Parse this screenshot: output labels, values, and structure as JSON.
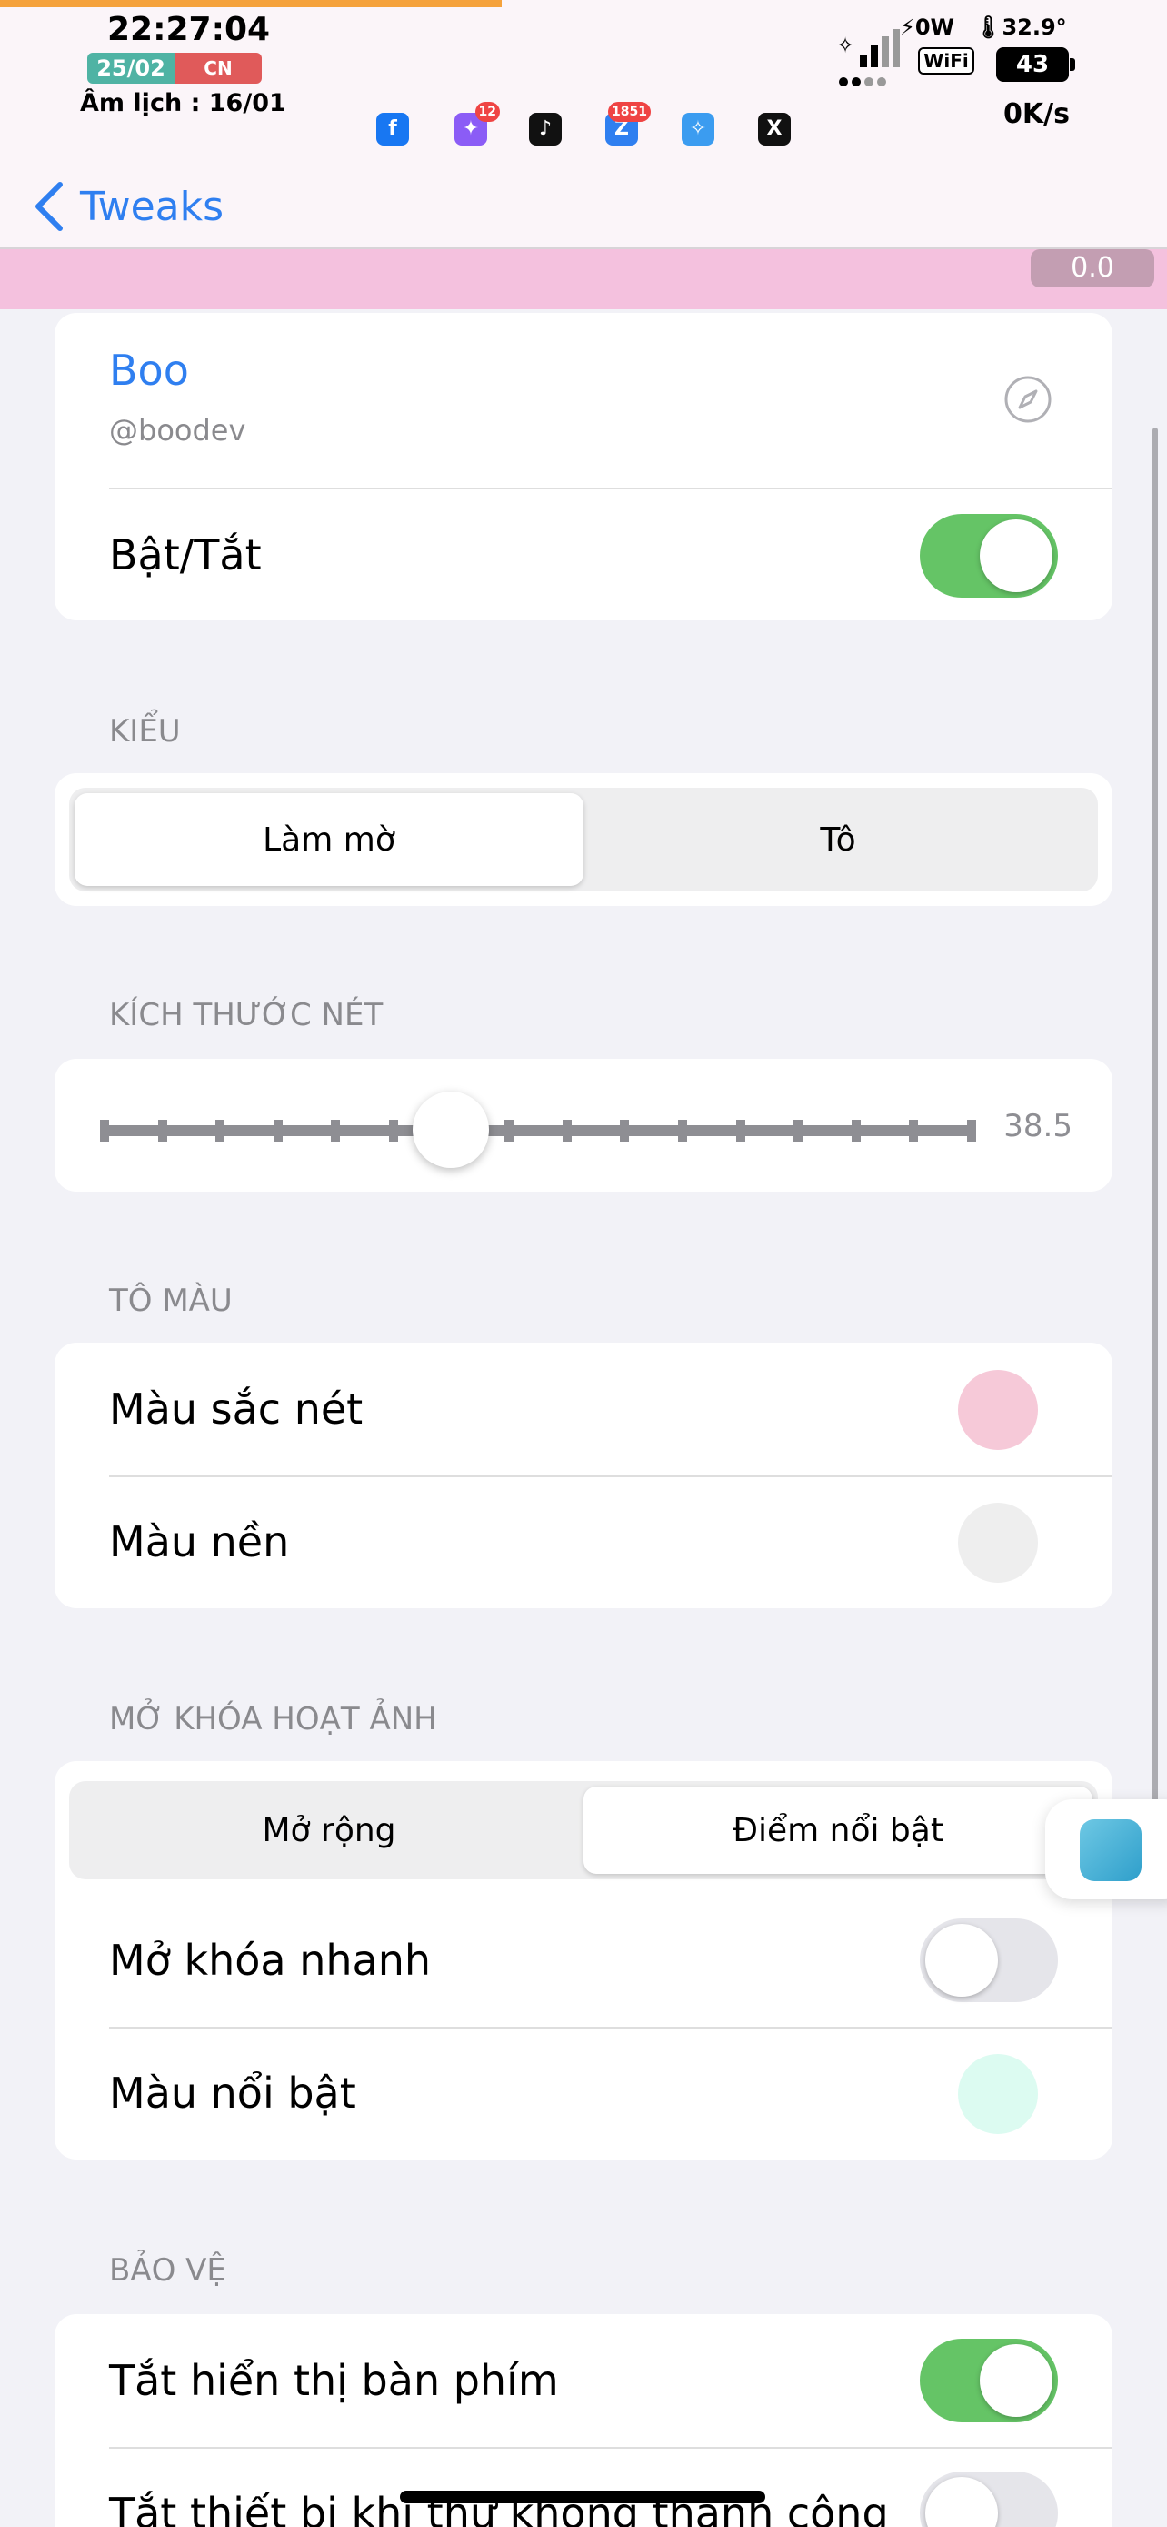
{
  "status_bar": {
    "time": "22:27:04",
    "date": "25/02",
    "day": "CN",
    "lunar": "Âm lịch : 16/01",
    "wattage": "⚡0W",
    "temperature": "🌡32.9°",
    "wifi": "WiFi",
    "battery": "43",
    "net_speed": "0K/s",
    "apps": [
      {
        "name": "facebook-icon",
        "glyph": "f",
        "color": "#1877f2",
        "badge": ""
      },
      {
        "name": "messenger-icon",
        "glyph": "✦",
        "color": "#8b5cf6",
        "badge": "12"
      },
      {
        "name": "tiktok-icon",
        "glyph": "♪",
        "color": "#111111",
        "badge": ""
      },
      {
        "name": "zalo-icon",
        "glyph": "Z",
        "color": "#2f7ff0",
        "badge": "1851"
      },
      {
        "name": "safari-icon",
        "glyph": "✧",
        "color": "#3b9cf0",
        "badge": ""
      },
      {
        "name": "x-icon",
        "glyph": "X",
        "color": "#111111",
        "badge": ""
      }
    ]
  },
  "nav": {
    "back_label": "Tweaks"
  },
  "version": "0.0",
  "profile": {
    "name": "Boo",
    "handle": "@boodev",
    "enabled_label": "Bật/Tắt",
    "enabled": true
  },
  "style_section": {
    "title": "KIỂU",
    "options": [
      "Làm mờ",
      "Tô"
    ],
    "selected": 0
  },
  "stroke_section": {
    "title": "KÍCH THƯỚC NÉT",
    "value": "38.5",
    "fraction": 0.4
  },
  "color_section": {
    "title": "TÔ MÀU",
    "stroke_color_label": "Màu sắc nét",
    "stroke_color": "#f6c9d8",
    "bg_color_label": "Màu nền",
    "bg_color": "#eeeeee"
  },
  "unlock_section": {
    "title": "MỞ KHÓA HOẠT ẢNH",
    "options": [
      "Mở rộng",
      "Điểm nổi bật"
    ],
    "selected": 1,
    "quick_unlock_label": "Mở khóa nhanh",
    "quick_unlock": false,
    "highlight_color_label": "Màu nổi bật",
    "highlight_color": "#dcfbf1"
  },
  "protect_section": {
    "title": "BẢO VỆ",
    "hide_keyboard_label": "Tắt hiển thị bàn phím",
    "hide_keyboard": true,
    "disable_device_label": "Tắt thiết bị khi thử không thành công",
    "disable_device": false
  }
}
